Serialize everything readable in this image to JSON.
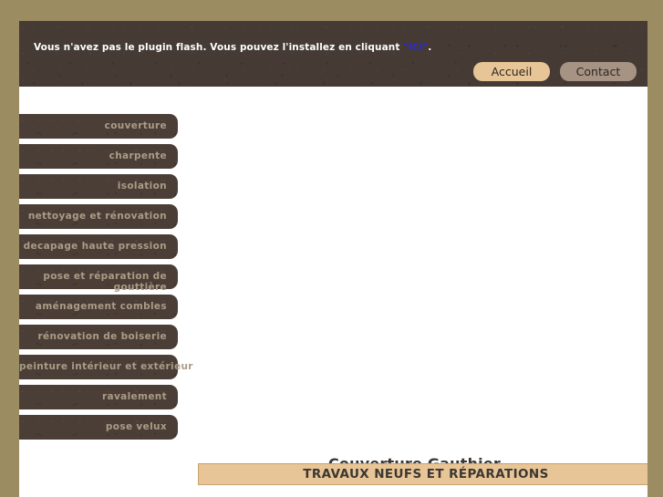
{
  "page": {
    "background_color": "#9c8c62",
    "content_background": "#ffffff",
    "panel_color": "#453a34"
  },
  "header": {
    "notice_prefix": "Vous n'avez pas le plugin flash. Vous pouvez l'installez en cliquant ",
    "notice_link": "\"ICI\"",
    "notice_suffix": ".",
    "link_color": "#2b2bd8",
    "nav": [
      {
        "label": "Accueil",
        "state": "active",
        "color": "#e8c596"
      },
      {
        "label": "Contact",
        "state": "inactive",
        "color": "#a69383"
      }
    ]
  },
  "sidebar": {
    "items": [
      {
        "label": "couverture"
      },
      {
        "label": "charpente"
      },
      {
        "label": "isolation"
      },
      {
        "label": "nettoyage et rénovation"
      },
      {
        "label": "decapage haute pression"
      },
      {
        "label": "pose et réparation de",
        "overflow_tail": "gouttière"
      },
      {
        "label": "aménagement combles"
      },
      {
        "label": "rénovation de boiserie"
      },
      {
        "label": "peinture intérieur et extérieur"
      },
      {
        "label": "ravalement"
      },
      {
        "label": "pose velux"
      }
    ],
    "text_color": "#ab9c87",
    "button_color": "#4a3e37"
  },
  "main": {
    "site_title": "Couverture Gauthier",
    "tagline": "TRAVAUX NEUFS ET RÉPARATIONS",
    "tagline_background": "#e8c596"
  }
}
